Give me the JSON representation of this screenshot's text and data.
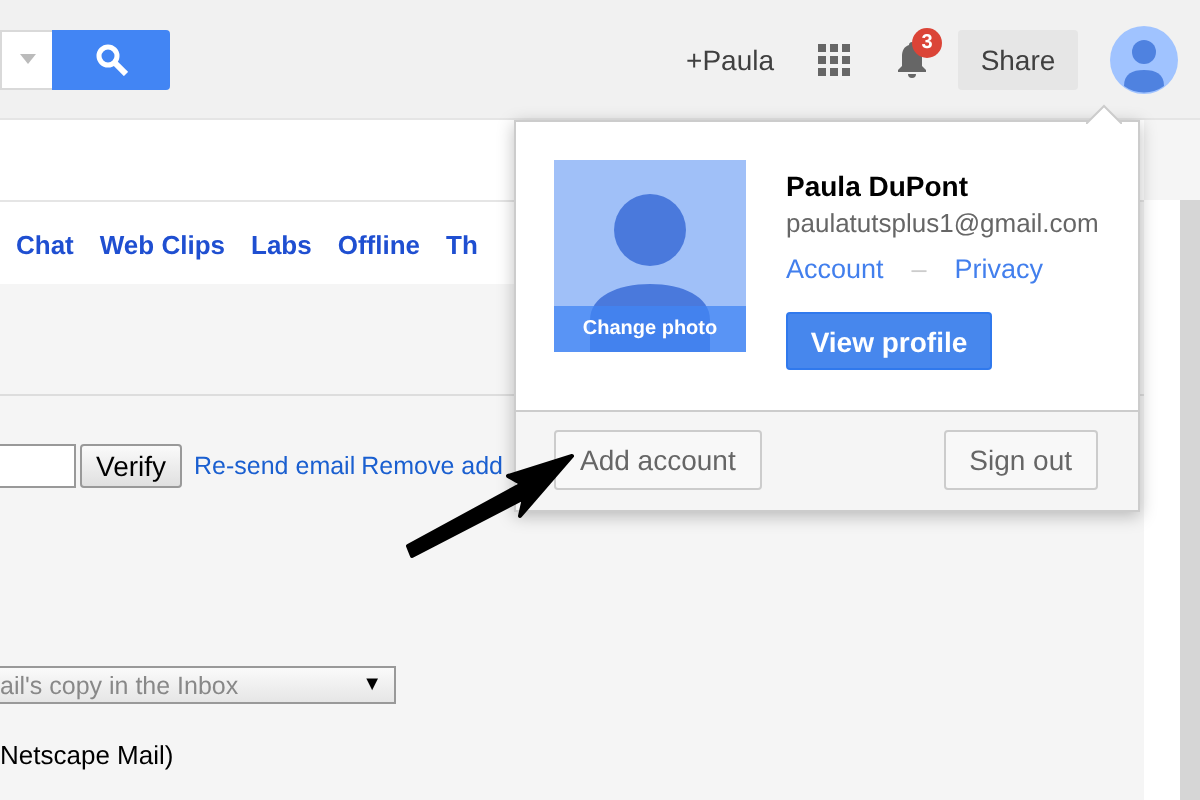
{
  "header": {
    "profile_link": "+Paula",
    "notification_count": "3",
    "share_button": "Share"
  },
  "tabs": [
    {
      "label": "Chat"
    },
    {
      "label": "Web Clips"
    },
    {
      "label": "Labs"
    },
    {
      "label": "Offline"
    },
    {
      "label": "Th"
    }
  ],
  "verify_row": {
    "button": "Verify",
    "links": [
      "Re-send email",
      "Remove add"
    ]
  },
  "forwarding_select": {
    "value": "ail's copy in the Inbox",
    "caret": "▼"
  },
  "note": "Netscape Mail)",
  "account_popup": {
    "change_photo": "Change photo",
    "name": "Paula DuPont",
    "email": "paulatutsplus1@gmail.com",
    "links": [
      "Account",
      "Privacy"
    ],
    "separator": "–",
    "view_profile": "View profile",
    "add_account": "Add account",
    "sign_out": "Sign out"
  }
}
